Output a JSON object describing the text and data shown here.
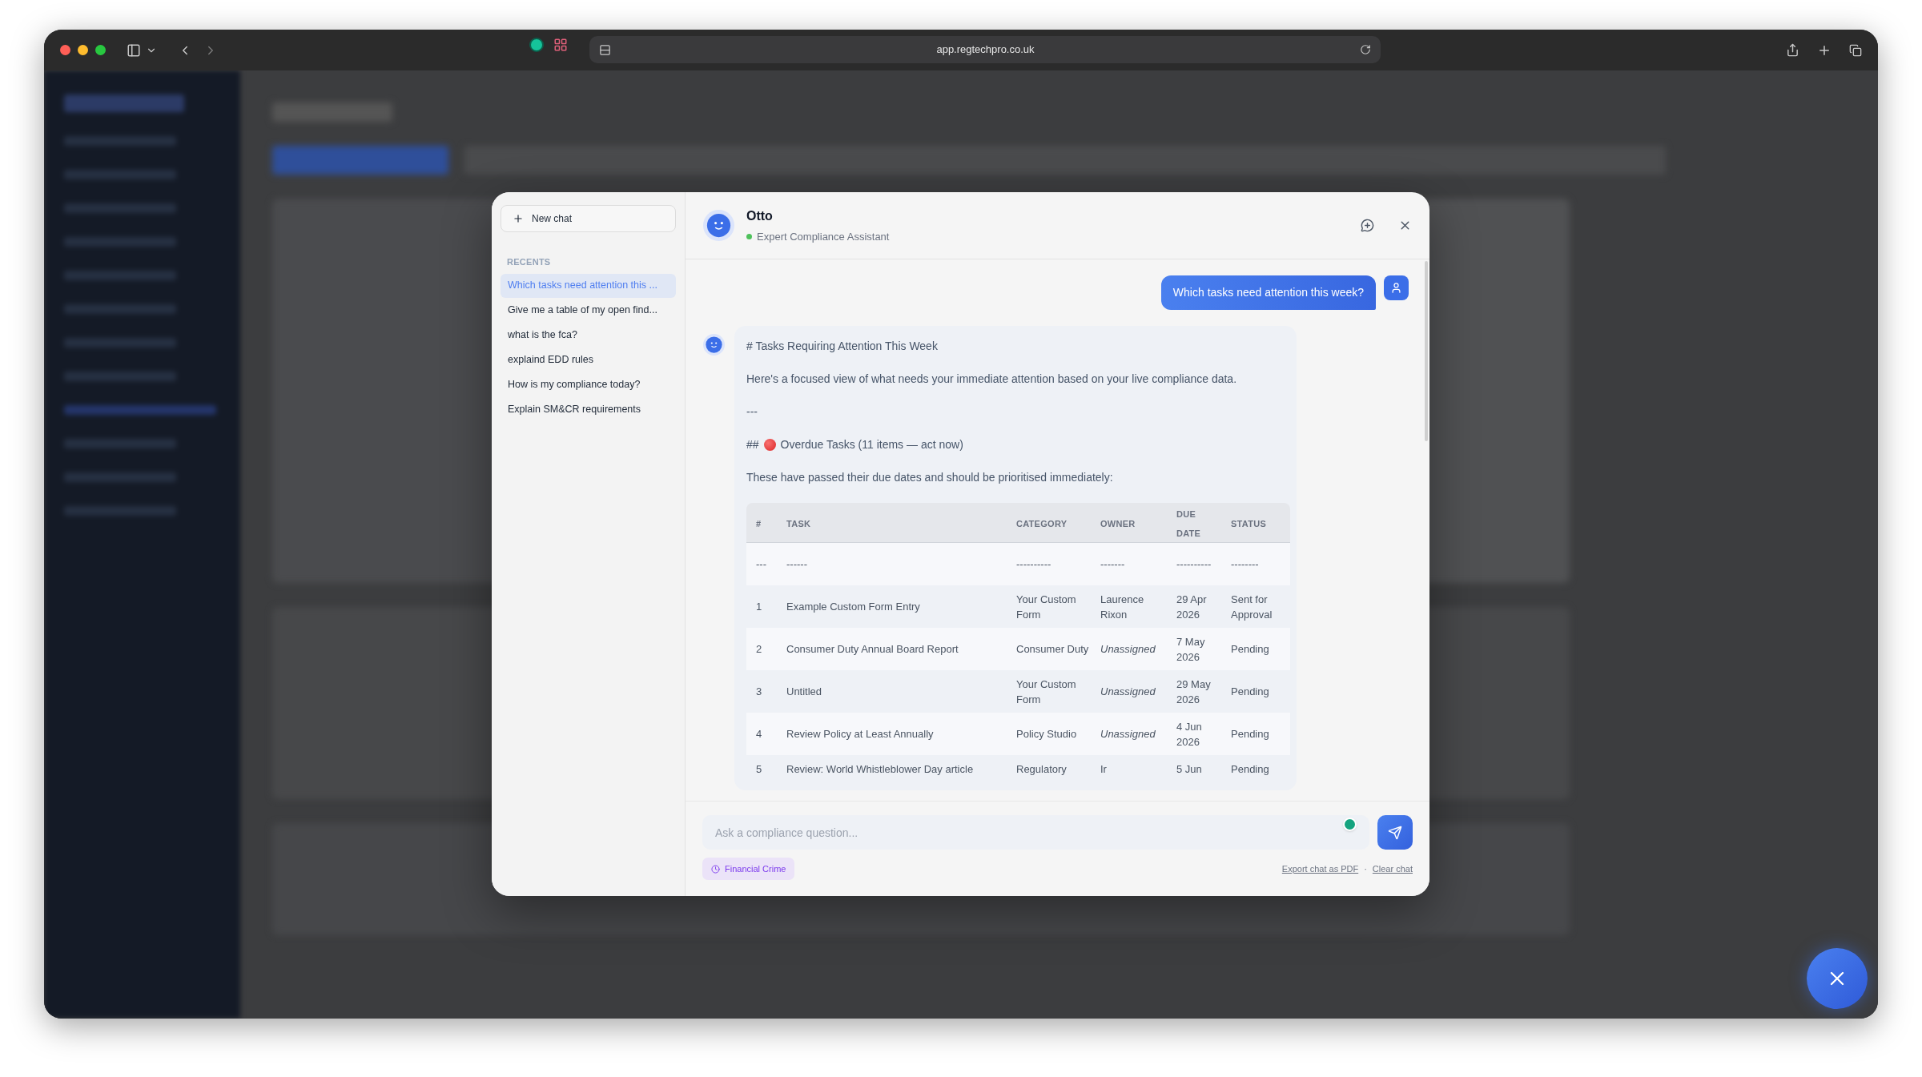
{
  "browser": {
    "url": "app.regtechpro.co.uk"
  },
  "chat_sidebar": {
    "new_chat": "New chat",
    "recents_label": "RECENTS",
    "recents": [
      {
        "label": "Which tasks need attention this ...",
        "selected": true
      },
      {
        "label": "Give me a table of my open find...",
        "selected": false
      },
      {
        "label": "what is the fca?",
        "selected": false
      },
      {
        "label": "explaind EDD rules",
        "selected": false
      },
      {
        "label": "How is my compliance today?",
        "selected": false
      },
      {
        "label": "Explain SM&CR requirements",
        "selected": false
      }
    ]
  },
  "assistant": {
    "name": "Otto",
    "subtitle": "Expert Compliance Assistant",
    "online": true
  },
  "messages": [
    {
      "kind": "user",
      "text": "Which tasks need attention this week?"
    },
    {
      "kind": "assistant",
      "blocks": [
        {
          "kind": "paragraph",
          "text": "# Tasks Requiring Attention This Week"
        },
        {
          "kind": "paragraph",
          "text": "Here's a focused view of what needs your immediate attention based on your live compliance data."
        },
        {
          "kind": "paragraph",
          "text": "---"
        },
        {
          "kind": "heading",
          "prefix": "##",
          "text": "Overdue Tasks (11 items — act now)"
        },
        {
          "kind": "paragraph",
          "text": "These have passed their due dates and should be prioritised immediately:"
        },
        {
          "kind": "table",
          "columns": [
            "#",
            "TASK",
            "CATEGORY",
            "OWNER",
            "DUE DATE",
            "STATUS"
          ],
          "rows": [
            {
              "cells": [
                "---",
                "------",
                "----------",
                "-------",
                "----------",
                "--------"
              ],
              "assigned": true
            },
            {
              "cells": [
                "1",
                "Example Custom Form Entry",
                "Your Custom Form",
                "Laurence Rixon",
                "29 Apr 2026",
                "Sent for Approval"
              ],
              "assigned": true
            },
            {
              "cells": [
                "2",
                "Consumer Duty Annual Board Report",
                "Consumer Duty",
                "Unassigned",
                "7 May 2026",
                "Pending"
              ],
              "assigned": false
            },
            {
              "cells": [
                "3",
                "Untitled",
                "Your Custom Form",
                "Unassigned",
                "29 May 2026",
                "Pending"
              ],
              "assigned": false
            },
            {
              "cells": [
                "4",
                "Review Policy at Least Annually",
                "Policy Studio",
                "Unassigned",
                "4 Jun 2026",
                "Pending"
              ],
              "assigned": false
            },
            {
              "cells": [
                "5",
                "Review: World Whistleblower Day article",
                "Regulatory",
                "Ir",
                "5 Jun",
                "Pending"
              ],
              "assigned": true
            }
          ]
        }
      ]
    }
  ],
  "composer": {
    "placeholder": "Ask a compliance question...",
    "topic_chip": "Financial Crime",
    "links": [
      "Export chat as PDF",
      "Clear chat"
    ],
    "separator": "·"
  }
}
